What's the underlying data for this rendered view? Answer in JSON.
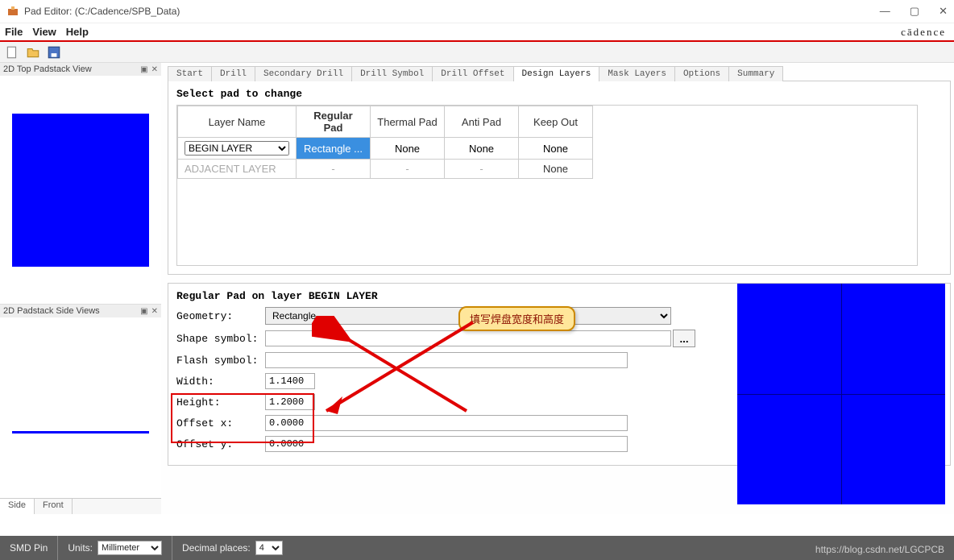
{
  "window": {
    "title": "Pad Editor:   (C:/Cadence/SPB_Data)",
    "brand": "cādence"
  },
  "menu": {
    "file": "File",
    "view": "View",
    "help": "Help"
  },
  "sidebar": {
    "panel1_title": "2D Top Padstack View",
    "panel2_title": "2D Padstack Side Views",
    "tabs": {
      "side": "Side",
      "front": "Front"
    }
  },
  "tabs": {
    "start": "Start",
    "drill": "Drill",
    "secondary_drill": "Secondary Drill",
    "drill_symbol": "Drill Symbol",
    "drill_offset": "Drill Offset",
    "design_layers": "Design Layers",
    "mask_layers": "Mask Layers",
    "options": "Options",
    "summary": "Summary"
  },
  "group1": {
    "title": "Select pad to change",
    "headers": {
      "layer": "Layer Name",
      "regular": "Regular Pad",
      "thermal": "Thermal Pad",
      "anti": "Anti Pad",
      "keepout": "Keep Out"
    },
    "rows": {
      "begin": {
        "layer": "BEGIN LAYER",
        "regular": "Rectangle ...",
        "thermal": "None",
        "anti": "None",
        "keepout": "None"
      },
      "adjacent": {
        "layer": "ADJACENT LAYER",
        "regular": "-",
        "thermal": "-",
        "anti": "-",
        "keepout": "None"
      }
    }
  },
  "group2": {
    "title": "Regular Pad on layer BEGIN LAYER",
    "labels": {
      "geometry": "Geometry:",
      "shape": "Shape symbol:",
      "flash": "Flash symbol:",
      "width": "Width:",
      "height": "Height:",
      "ox": "Offset x:",
      "oy": "Offset y:"
    },
    "values": {
      "geometry": "Rectangle",
      "shape": "",
      "flash": "",
      "width": "1.1400",
      "height": "1.2000",
      "ox": "0.0000",
      "oy": "0.0000"
    },
    "dots": "..."
  },
  "annotation": {
    "callout": "填写焊盘宽度和高度"
  },
  "status": {
    "smd": "SMD Pin",
    "units_label": "Units:",
    "units_value": "Millimeter",
    "dec_label": "Decimal places:",
    "dec_value": "4",
    "watermark": "https://blog.csdn.net/LGCPCB"
  }
}
